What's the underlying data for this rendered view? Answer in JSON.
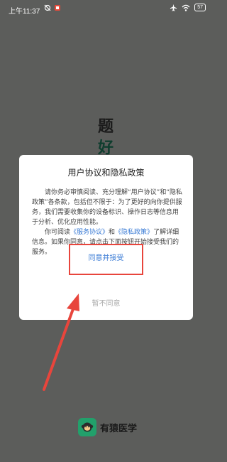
{
  "status_bar": {
    "time": "上午11:37",
    "battery": "57"
  },
  "background": {
    "title_line1": "题",
    "title_line2": "好"
  },
  "dialog": {
    "title": "用户协议和隐私政策",
    "para1": "请你务必审慎阅读、充分理解“用户协议”和“隐私政策”各条款，包括但不限于：为了更好的向你提供服务，我们需要收集你的设备标识、操作日志等信息用于分析、优化应用性能。",
    "para2_prefix": "你可阅读",
    "para2_link1": "《服务协议》",
    "para2_and": "和",
    "para2_link2": "《隐私政策》",
    "para2_suffix": "了解详细信息。如果你同意，请点击下面按钮开始接受我们的服务。",
    "agree_label": "同意并接受",
    "disagree_label": "暂不同意"
  },
  "app": {
    "logo_text": "有猿医学"
  },
  "colors": {
    "background": "#5c5d5b",
    "link": "#3a7bd5",
    "annotation": "#e8453c",
    "brand": "#22a06b"
  }
}
